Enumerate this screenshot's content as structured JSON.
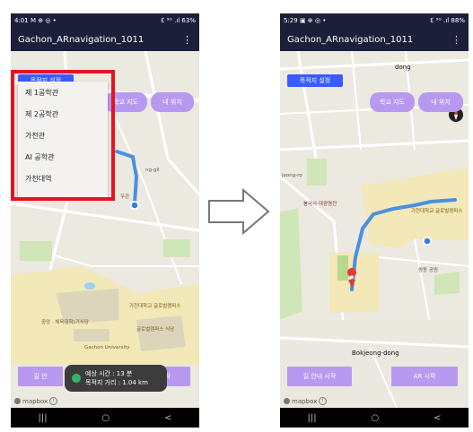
{
  "left": {
    "status": {
      "time": "4:01",
      "icons": "M ⊕ ◎ •",
      "right": "ℇ ⁹ᴳ .ıl 63%"
    },
    "appbar": {
      "title": "Gachon_ARnavigation_1011",
      "menu": "⋮"
    },
    "buttons": {
      "destination": "목적지 설정",
      "school_map": "학교 지도",
      "my_location": "내 위치",
      "guide_start": "길 안",
      "ar_start": "작"
    },
    "dropdown": {
      "items": [
        "제 1공학관",
        "제 2공학관",
        "가천관",
        "AI 공학관",
        "가천대역"
      ]
    },
    "toast": {
      "line1": "예상 시간 : 13 분",
      "line2": "목적지 거리 : 1.04 km"
    },
    "map_labels": {
      "building1": "무관",
      "road": "ng-gil",
      "univ": "Gachon University",
      "campus_a": "중앙 · 체육대학(기식당",
      "campus_b": "가천대학교\n글로벌캠퍼스",
      "food": "글로벌캠퍼스 식당"
    },
    "mapbox": "mapbox",
    "nav": [
      "|||",
      "○",
      "<"
    ]
  },
  "right": {
    "status": {
      "time": "5:29",
      "icons": "▣ ⊕ ◎ •",
      "right": "ℇ ⁹ᴳ .ıl 88%"
    },
    "appbar": {
      "title": "Gachon_ARnavigation_1011",
      "menu": "⋮"
    },
    "buttons": {
      "destination": "목적지 설정",
      "school_map": "학교 지도",
      "my_location": "내 위치",
      "guide_start": "길 안내 시작",
      "ar_start": "AR 시작"
    },
    "map_labels": {
      "top": "dong",
      "road": "jeong-ro",
      "temple": "봉국사 대광명전",
      "campus": "가천대학교\n글로벌캠퍼스",
      "park": "쌍동 공원",
      "district": "Bokjeong-dong"
    },
    "mapbox": "mapbox",
    "nav": [
      "|||",
      "○",
      "<"
    ]
  },
  "colors": {
    "appbar": "#1c1f3a",
    "accent_blue": "#3a5bff",
    "button_purple": "#b79af0",
    "route": "#4a90e2",
    "highlight_red": "#e8121e"
  }
}
